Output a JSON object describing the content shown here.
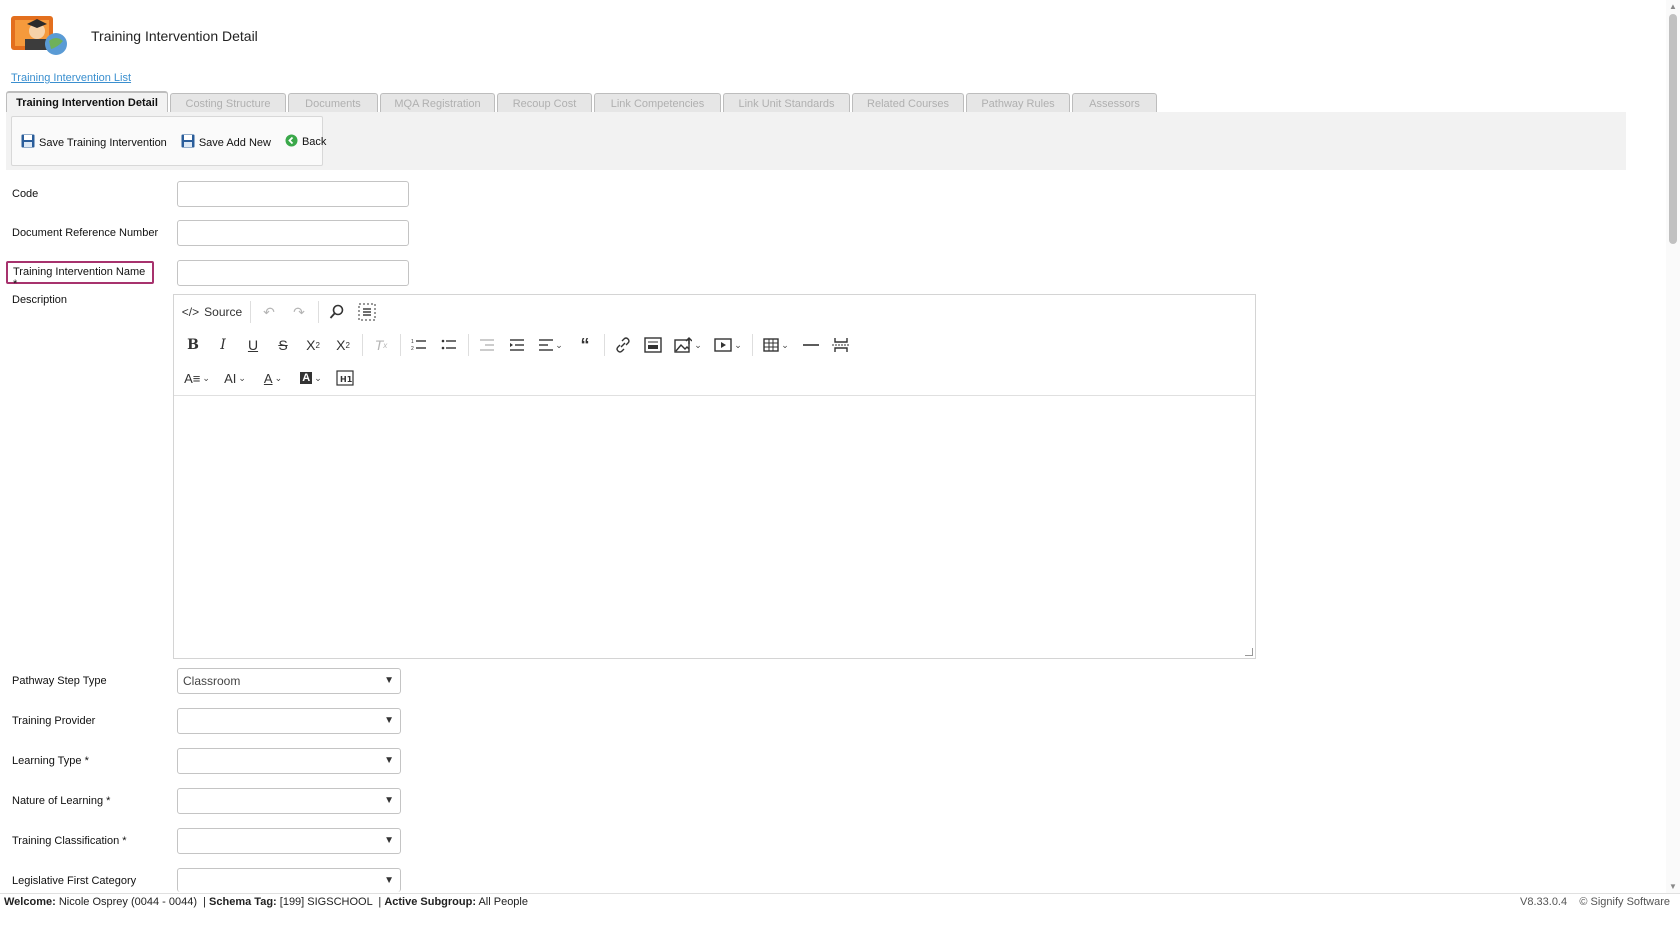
{
  "header": {
    "title": "Training Intervention Detail"
  },
  "breadcrumb": "Training Intervention List",
  "tabs": [
    {
      "label": "Training Intervention Detail",
      "active": true
    },
    {
      "label": "Costing Structure"
    },
    {
      "label": "Documents"
    },
    {
      "label": "MQA Registration"
    },
    {
      "label": "Recoup Cost"
    },
    {
      "label": "Link Competencies"
    },
    {
      "label": "Link Unit Standards"
    },
    {
      "label": "Related Courses"
    },
    {
      "label": "Pathway Rules"
    },
    {
      "label": "Assessors"
    }
  ],
  "toolbar": {
    "save_label": "Save Training Intervention",
    "save_add_label": "Save Add New",
    "back_label": "Back"
  },
  "form": {
    "code_label": "Code",
    "code_value": "",
    "docref_label": "Document Reference Number",
    "docref_value": "",
    "name_label": "Training Intervention Name *",
    "name_value": "",
    "description_label": "Description",
    "source_label": "Source",
    "pathway_label": "Pathway Step Type",
    "pathway_value": "Classroom",
    "provider_label": "Training Provider",
    "provider_value": "",
    "learning_type_label": "Learning Type *",
    "learning_type_value": "",
    "nature_label": "Nature of Learning *",
    "nature_value": "",
    "classification_label": "Training Classification *",
    "classification_value": "",
    "legislative_label": "Legislative First Category",
    "legislative_value": ""
  },
  "status": {
    "welcome_label": "Welcome:",
    "welcome_value": "Nicole Osprey (0044 - 0044)",
    "schema_label": "Schema Tag:",
    "schema_value": "[199] SIGSCHOOL",
    "subgroup_label": "Active Subgroup:",
    "subgroup_value": "All People",
    "version": "V8.33.0.4",
    "copyright": "© Signify Software"
  },
  "colors": {
    "accent": "#e8a23a",
    "required_highlight": "#a7326d",
    "link": "#3a8fcf"
  }
}
